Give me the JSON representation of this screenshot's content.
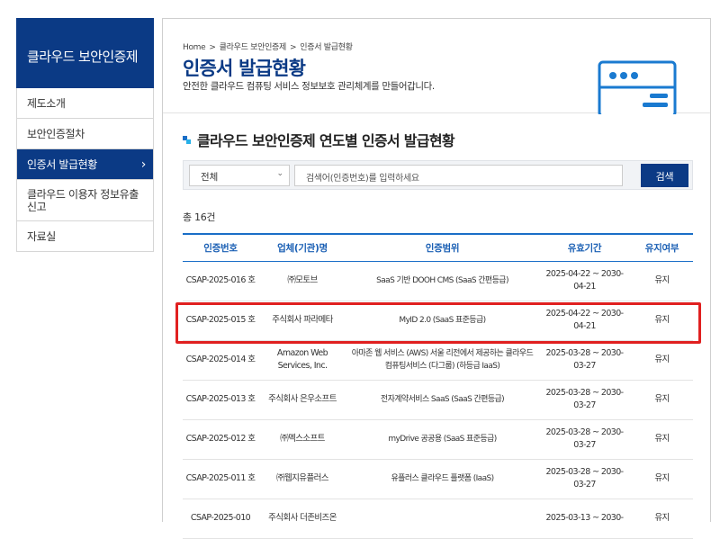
{
  "sidebar": {
    "title": "클라우드 보안인증제",
    "items": [
      {
        "label": "제도소개"
      },
      {
        "label": "보안인증절차"
      },
      {
        "label": "인증서 발급현황",
        "arrow": "›"
      },
      {
        "label": "클라우드 이용자 정보유출 신고"
      },
      {
        "label": "자료실"
      }
    ]
  },
  "breadcrumb": [
    "Home",
    ">",
    "클라우드 보안인증제",
    ">",
    "인증서 발급현황"
  ],
  "page": {
    "title": "인증서 발급현황",
    "subtitle": "안전한 클라우드 컴퓨팅 서비스 정보보호 관리체계를 만들어갑니다."
  },
  "section_title": "클라우드 보안인증제 연도별 인증서 발급현황",
  "search": {
    "select_value": "전체",
    "placeholder": "검색어(인증번호)를 입력하세요",
    "button_label": "검색"
  },
  "total_label": "총 16건",
  "table": {
    "headers": [
      "인증번호",
      "업체(기관)명",
      "인증범위",
      "유효기간",
      "유지여부"
    ],
    "rows": [
      {
        "id": "CSAP-2025-016 호",
        "company": "㈜모토브",
        "scope": "SaaS 기반 DOOH CMS (SaaS 간편등급)",
        "period": "2025-04-22 ~ 2030-04-21",
        "status": "유지"
      },
      {
        "id": "CSAP-2025-015 호",
        "company": "주식회사 파라메타",
        "scope": "MyID 2.0 (SaaS 표준등급)",
        "period": "2025-04-22 ~ 2030-04-21",
        "status": "유지"
      },
      {
        "id": "CSAP-2025-014 호",
        "company": "Amazon Web Services, Inc.",
        "scope": "아마존 웹 서비스 (AWS) 서울 리전에서 제공하는 클라우드컴퓨팅서비스 (다그룹) (하등급 IaaS)",
        "period": "2025-03-28 ~ 2030-03-27",
        "status": "유지"
      },
      {
        "id": "CSAP-2025-013 호",
        "company": "주식회사 은우소프트",
        "scope": "전자계약서비스 SaaS (SaaS 간편등급)",
        "period": "2025-03-28 ~ 2030-03-27",
        "status": "유지"
      },
      {
        "id": "CSAP-2025-012 호",
        "company": "㈜멕스소프트",
        "scope": "myDrive 공공용 (SaaS 표준등급)",
        "period": "2025-03-28 ~ 2030-03-27",
        "status": "유지"
      },
      {
        "id": "CSAP-2025-011 호",
        "company": "㈜웹지유플러스",
        "scope": "유플러스 클라우드 플랫폼 (IaaS)",
        "period": "2025-03-28 ~ 2030-03-27",
        "status": "유지"
      },
      {
        "id": "CSAP-2025-010",
        "company": "주식회사 더존비즈온",
        "scope": "",
        "period": "2025-03-13 ~ 2030-",
        "status": "유지"
      }
    ]
  },
  "colors": {
    "brand": "#0b3a85",
    "accent": "#1a6ec7",
    "highlight": "#e02020"
  }
}
